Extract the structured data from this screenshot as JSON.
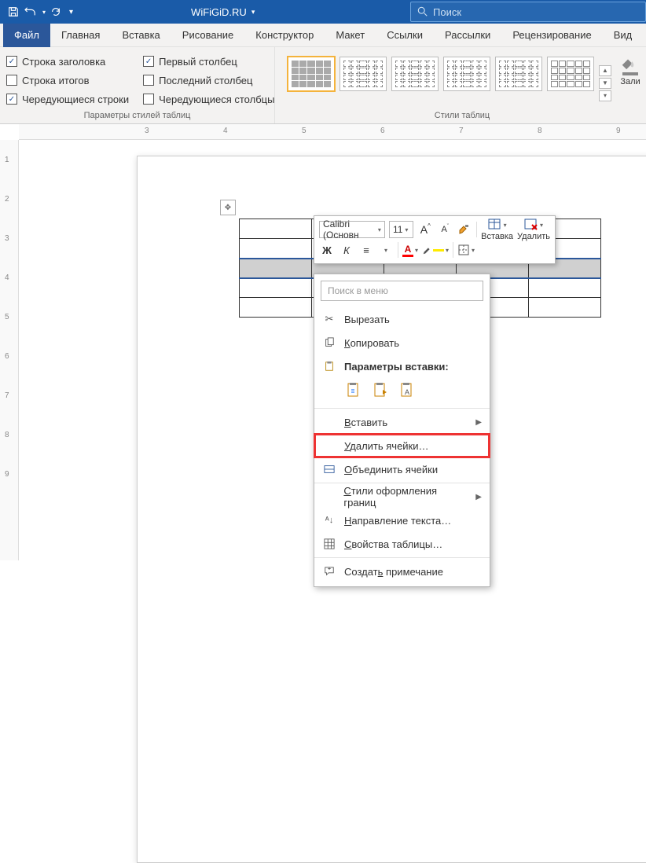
{
  "title": "WiFiGiD.RU",
  "search_placeholder": "Поиск",
  "tabs": {
    "file": "Файл",
    "home": "Главная",
    "insert": "Вставка",
    "draw": "Рисование",
    "design": "Конструктор",
    "layout": "Макет",
    "references": "Ссылки",
    "mailings": "Рассылки",
    "review": "Рецензирование",
    "view": "Вид"
  },
  "table_options": {
    "header_row": "Строка заголовка",
    "total_row": "Строка итогов",
    "banded_rows": "Чередующиеся строки",
    "first_column": "Первый столбец",
    "last_column": "Последний столбец",
    "banded_columns": "Чередующиеся столбцы",
    "group_label": "Параметры стилей таблиц"
  },
  "table_styles": {
    "group_label": "Стили таблиц",
    "fill_label": "Зали"
  },
  "mini_toolbar": {
    "font_name": "Calibri (Основн",
    "font_size": "11",
    "insert": "Вставка",
    "delete": "Удалить",
    "bold": "Ж",
    "italic": "К",
    "equal": "≡"
  },
  "context_menu": {
    "search_placeholder": "Поиск в меню",
    "cut": "Вырезать",
    "copy": "Копировать",
    "paste_options_label": "Параметры вставки:",
    "insert": "Вставить",
    "delete_cells": "Удалить ячейки…",
    "merge_cells": "Объединить ячейки",
    "border_styles": "Стили оформления границ",
    "text_direction": "Направление текста…",
    "table_properties": "Свойства таблицы…",
    "new_comment": "Создать примечание"
  },
  "ruler_h": [
    "3",
    "4",
    "5",
    "6",
    "7",
    "8",
    "9"
  ],
  "ruler_v": [
    "1",
    "2",
    "3",
    "4",
    "5",
    "6",
    "7",
    "8",
    "9"
  ]
}
